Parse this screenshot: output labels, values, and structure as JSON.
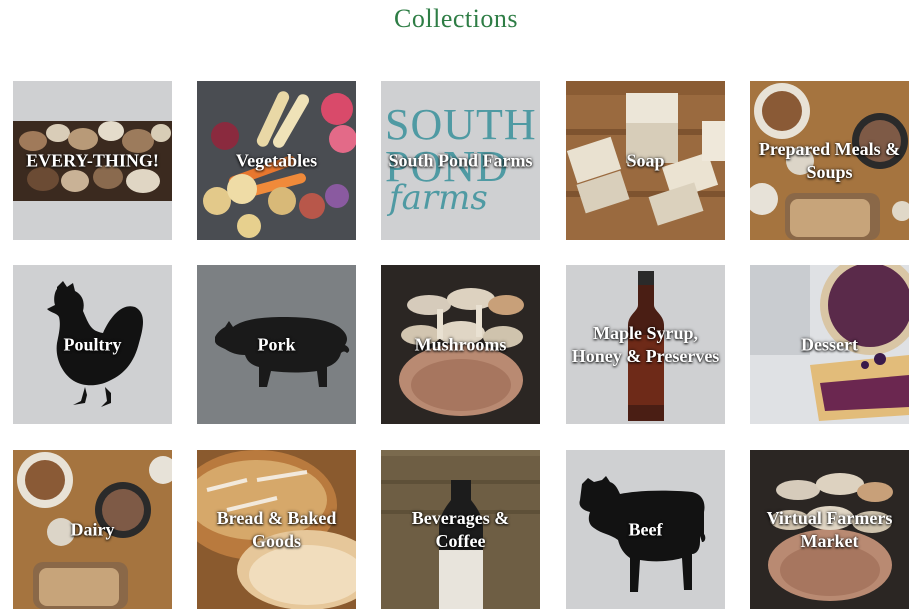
{
  "page": {
    "title": "Collections"
  },
  "collections": [
    {
      "label": "EVERY-THING!",
      "kind": "photo-mushroom-strip"
    },
    {
      "label": "Vegetables",
      "kind": "photo-vegetables"
    },
    {
      "label": "South Pond Farms",
      "kind": "logo",
      "logo_text": {
        "line1": "SOUTH",
        "line2": "POND",
        "line3": "farms"
      }
    },
    {
      "label": "Soap",
      "kind": "photo-soap"
    },
    {
      "label": "Prepared Meals & Soups",
      "kind": "photo-table"
    },
    {
      "label": "Poultry",
      "kind": "silhouette",
      "icon": "chicken-icon"
    },
    {
      "label": "Pork",
      "kind": "silhouette",
      "icon": "pig-icon"
    },
    {
      "label": "Mushrooms",
      "kind": "photo-mushroom-hands"
    },
    {
      "label": "Maple Syrup, Honey & Preserves",
      "kind": "photo-bottle"
    },
    {
      "label": "Dessert",
      "kind": "photo-pie"
    },
    {
      "label": "Dairy",
      "kind": "photo-table"
    },
    {
      "label": "Bread & Baked Goods",
      "kind": "photo-bread"
    },
    {
      "label": "Beverages & Coffee",
      "kind": "photo-bottle-dark"
    },
    {
      "label": "Beef",
      "kind": "silhouette",
      "icon": "cow-icon"
    },
    {
      "label": "Virtual Farmers Market",
      "kind": "photo-mushroom-hands"
    }
  ],
  "colors": {
    "title": "#2e7d45",
    "tile_light_gray": "#cfd0d2",
    "tile_dark_gray": "#7c8083",
    "logo_teal": "#4f9aa3"
  }
}
